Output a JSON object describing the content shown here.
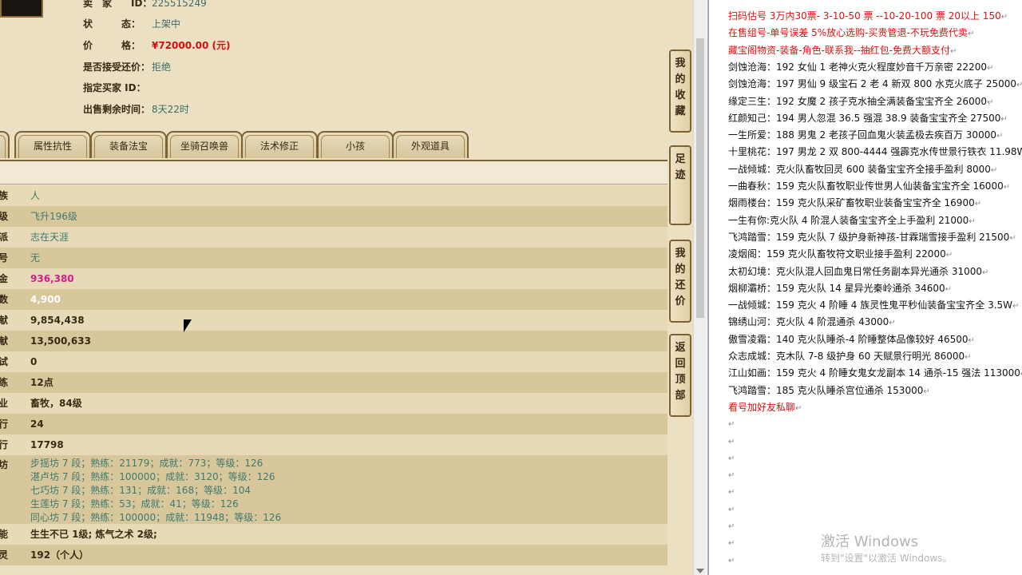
{
  "listing": {
    "seller_label": "卖　家　　ID：",
    "seller_id": "225515249",
    "status_label": "状　　　态：",
    "status_value": "上架中",
    "price_label": "价　　　格：",
    "price_value": "¥72000.00 (元)",
    "bargain_label": "是否接受还价：",
    "bargain_value": "拒绝",
    "buyer_label": "指定买家 ID：",
    "buyer_value": "",
    "time_label": "出售剩余时间：",
    "time_value": "8天22时"
  },
  "tabs": [
    "",
    "属性抗性",
    "装备法宝",
    "坐骑召唤兽",
    "法术修正",
    "小孩",
    "外观道具"
  ],
  "rows": [
    {
      "label": "族",
      "value": "人",
      "style": "teal"
    },
    {
      "label": "级",
      "value": "飞升196级",
      "style": "teal"
    },
    {
      "label": "派",
      "value": "志在天涯",
      "style": "teal"
    },
    {
      "label": "号",
      "value": "无",
      "style": "teal"
    },
    {
      "label": "金",
      "value": "936,380",
      "style": "pink"
    },
    {
      "label": "数",
      "value": "4,900",
      "style": "white"
    },
    {
      "label": "献",
      "value": "9,854,438",
      "style": ""
    },
    {
      "label": "献",
      "value": "13,500,633",
      "style": ""
    },
    {
      "label": "试",
      "value": "0",
      "style": ""
    },
    {
      "label": "练",
      "value": "12点",
      "style": ""
    },
    {
      "label": "业",
      "value": "畜牧，84级",
      "style": ""
    },
    {
      "label": "行",
      "value": "24",
      "style": ""
    },
    {
      "label": "行",
      "value": "17798",
      "style": ""
    }
  ],
  "house": {
    "label": "坊",
    "lines": [
      "步摇坊 7 段；熟练：21179；成就：773；等级：126",
      "湛卢坊 7 段；熟练：100000；成就：3120；等级：126",
      "七巧坊 7 段；熟练：131；成就：168；等级：104",
      "生莲坊 7 段；熟练：53；成就：41；等级：126",
      "同心坊 7 段；熟练：100000；成就：11948；等级：126"
    ]
  },
  "rows_after": [
    {
      "label": "能",
      "value": "生生不已 1级; 炼气之术 2级;",
      "style": ""
    },
    {
      "label": "灵",
      "value": "192（个人）",
      "style": ""
    }
  ],
  "side_buttons": [
    {
      "name": "favorites",
      "chars": [
        "我",
        "的",
        "收",
        "藏"
      ]
    },
    {
      "name": "footprint",
      "chars": [
        "足",
        "迹"
      ]
    },
    {
      "name": "my-offers",
      "chars": [
        "我",
        "的",
        "还",
        "价"
      ]
    },
    {
      "name": "back-to-top",
      "chars": [
        "返",
        "回",
        "顶",
        "部"
      ]
    }
  ],
  "doc": {
    "lines": [
      {
        "text": "扫码估号 3万内30票- 3-10-50 票 --10-20-100 票  20以上 150",
        "red": true
      },
      {
        "text": "在售组号-单号误差 5%放心选购-买贵管退-不玩免费代卖",
        "red": true
      },
      {
        "text": "藏宝阁物资-装备-角色-联系我--抽红包-免费大额支付",
        "red": true
      },
      {
        "text": "剑蚀沧海：192 女仙 1 老神火克火程度妙音千万亲密 22200",
        "red": false
      },
      {
        "text": "剑蚀沧海：197 男仙 9 级宝石 2 老 4 新双 800 水克火底子 25000",
        "red": false
      },
      {
        "text": "缘定三生：192 女魔 2 孩子克水抽全满装备宝宝齐全 26000",
        "red": false
      },
      {
        "text": "红颜知己：194 男人忽混 36.5 强混 38.9 装备宝宝齐全 27500",
        "red": false
      },
      {
        "text": "一生所爱：188 男鬼 2 老孩子回血鬼火装孟极去疾百万 30000",
        "red": false
      },
      {
        "text": "十里桃花：197 男龙 2 双 800-4444 强霹克水传世景行铁衣 11.98W",
        "red": false
      },
      {
        "text": "一战倾城：克火队畜牧回灵 600 装备宝宝齐全接手盈利 8000",
        "red": false
      },
      {
        "text": "一曲春秋：159 克火队畜牧职业传世男人仙装备宝宝齐全 16000",
        "red": false
      },
      {
        "text": "烟雨楼台：159 克火队采矿畜牧职业装备宝宝齐全 16900",
        "red": false
      },
      {
        "text": "一生有你:克火队 4 阶混人装备宝宝齐全上手盈利 21000",
        "red": false
      },
      {
        "text": "飞鸿踏雪：159 克火队 7 级护身新神孩-甘霖瑞雪接手盈利 21500",
        "red": false
      },
      {
        "text": "凌烟阁：159 克火队畜牧符文职业接手盈利 22000",
        "red": false
      },
      {
        "text": "太初幻境：克火队混人回血鬼日常任务副本异光通杀 31000",
        "red": false
      },
      {
        "text": "烟柳灞桥：159 克火队 14 星异光秦岭通杀 34600",
        "red": false
      },
      {
        "text": "一战倾城：159 克火 4 阶睡 4 族灵性鬼平秒仙装备宝宝齐全 3.5W",
        "red": false
      },
      {
        "text": "锦绣山河：克火队 4 阶混通杀 43000",
        "red": false
      },
      {
        "text": "傲雪凌霜：140 克火队睡杀-4 阶睡整体品像较好 46500",
        "red": false
      },
      {
        "text": "众志成城：克木队 7-8 级护身 60 天赋景行明光 86000",
        "red": false
      },
      {
        "text": "江山如画：159 克火 4 阶睡女鬼女龙副本 14 通杀-15 强法 113000",
        "red": false
      },
      {
        "text": "飞鸿踏雪：185 克火队睡杀宫位通杀 153000",
        "red": false
      },
      {
        "text": "看号加好友私聊",
        "red": true
      }
    ],
    "para_mark": "↵",
    "watermark_title": "激活 Windows",
    "watermark_sub": "转到\"设置\"以激活 Windows。"
  }
}
